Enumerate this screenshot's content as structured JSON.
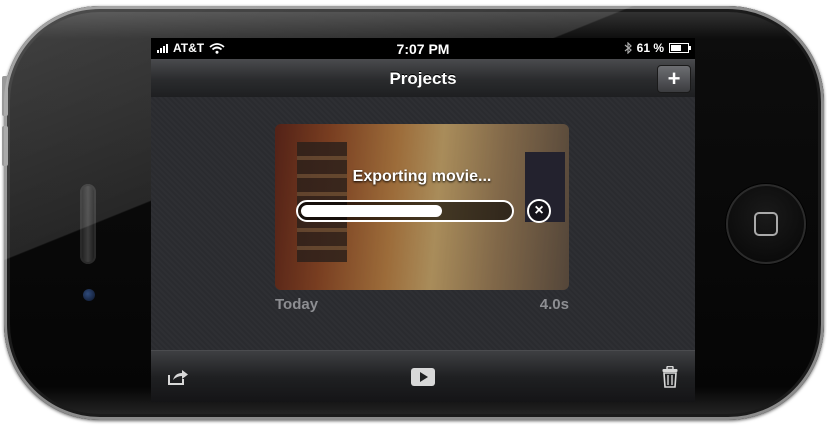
{
  "status_bar": {
    "carrier": "AT&T",
    "time": "7:07 PM",
    "battery": "61 %",
    "battery_level": 0.61
  },
  "nav": {
    "title": "Projects",
    "add_label": "+"
  },
  "project": {
    "export_status": "Exporting movie...",
    "progress": 0.68,
    "date": "Today",
    "duration": "4.0s"
  },
  "toolbar": {
    "share_icon": "share-icon",
    "play_icon": "play-icon",
    "trash_icon": "trash-icon"
  },
  "icons": {
    "signal": "signal-icon",
    "wifi": "wifi-icon",
    "bluetooth": "bluetooth-icon",
    "battery": "battery-icon",
    "cancel": "close-circle-icon"
  }
}
